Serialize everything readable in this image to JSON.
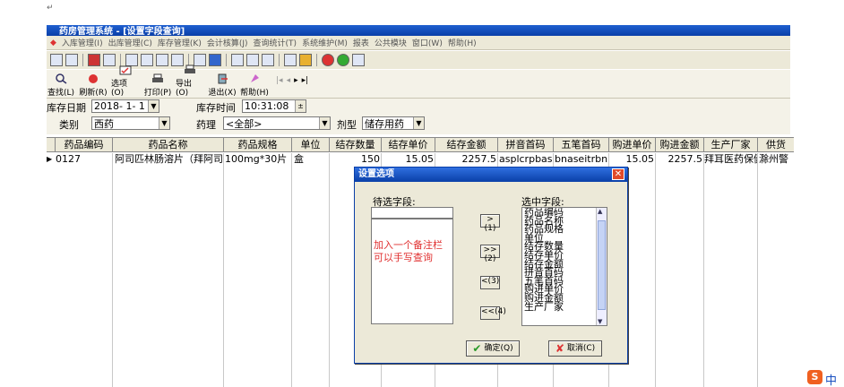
{
  "app": {
    "title": "药房管理系统 - [设置字段查询]"
  },
  "menu": [
    "入库管理(I)",
    "出库管理(C)",
    "库存管理(K)",
    "会计核算(J)",
    "查询统计(T)",
    "系统维护(M)",
    "报表",
    "公共模块",
    "窗口(W)",
    "帮助(H)"
  ],
  "toolbar2": [
    {
      "label": "查找(L)",
      "icon": "search-icon"
    },
    {
      "label": "刷新(R)",
      "icon": "refresh-icon"
    },
    {
      "label": "选项(O)",
      "icon": "options-icon"
    },
    {
      "label": "打印(P)",
      "icon": "print-icon"
    },
    {
      "label": "导出(O)",
      "icon": "export-icon"
    },
    {
      "label": "退出(X)",
      "icon": "exit-icon"
    },
    {
      "label": "帮助(H)",
      "icon": "help-icon"
    }
  ],
  "filters": {
    "date_label": "库存日期",
    "date_value": "2018- 1- 1",
    "time_label": "库存时间",
    "time_value": "10:31:08",
    "category_label": "类别",
    "category_value": "西药",
    "pharmacy_label": "药理",
    "pharmacy_value": "<全部>",
    "type_label": "剂型",
    "type_value": "储存用药"
  },
  "grid": {
    "columns": [
      "药品编码",
      "药品名称",
      "药品规格",
      "单位",
      "结存数量",
      "结存单价",
      "结存金额",
      "拼音首码",
      "五笔首码",
      "购进单价",
      "购进金额",
      "生产厂家",
      "供货"
    ],
    "rows": [
      [
        "0127",
        "阿司匹林肠溶片（拜阿司",
        "100mg*30片",
        "盒",
        "150",
        "15.05",
        "2257.5",
        "asplcrpbas",
        "bnaseitrbn",
        "15.05",
        "2257.5",
        "拜耳医药保健",
        "滁州警"
      ]
    ]
  },
  "dialog": {
    "title": "设置选项",
    "left_label": "待选字段:",
    "right_label": "选中字段:",
    "note": "加入一个备注栏\n可以手写查询",
    "btn_add": ">(1)",
    "btn_add_all": ">>(2)",
    "btn_remove": "<(3)",
    "btn_remove_all": "<<(4)",
    "ok": "确定(Q)",
    "cancel": "取消(C)",
    "selected": [
      "药品编码",
      "药品名称",
      "药品规格",
      "单位",
      "结存数量",
      "结存单价",
      "结存金额",
      "拼音首码",
      "五笔首码",
      "购进单价",
      "购进金额",
      "生产厂家"
    ]
  },
  "tray": {
    "ime": "中"
  },
  "colors": {
    "accent": "#0a3fa8",
    "note": "#e03030"
  }
}
